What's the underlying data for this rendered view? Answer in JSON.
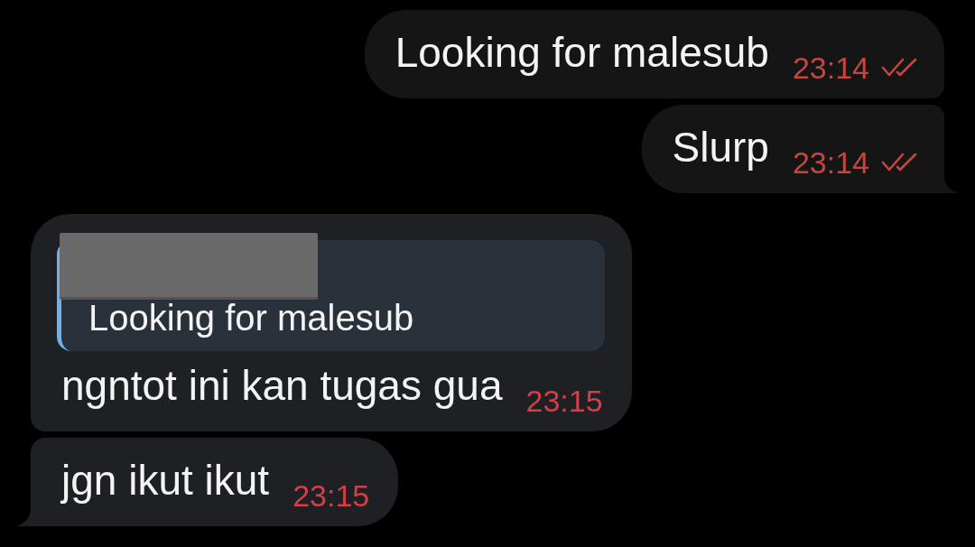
{
  "messages": [
    {
      "kind": "outgoing",
      "text": "Looking for malesub",
      "time": "23:14",
      "read": true,
      "tail": false
    },
    {
      "kind": "outgoing",
      "text": "Slurp",
      "time": "23:14",
      "read": true,
      "tail": true
    },
    {
      "kind": "incoming",
      "reply": {
        "text": "Looking for malesub",
        "sender_hidden": true
      },
      "text": "ngntot ini kan tugas gua",
      "time": "23:15",
      "tail": false
    },
    {
      "kind": "incoming",
      "text": "jgn ikut ikut",
      "time": "23:15",
      "tail": true
    }
  ]
}
